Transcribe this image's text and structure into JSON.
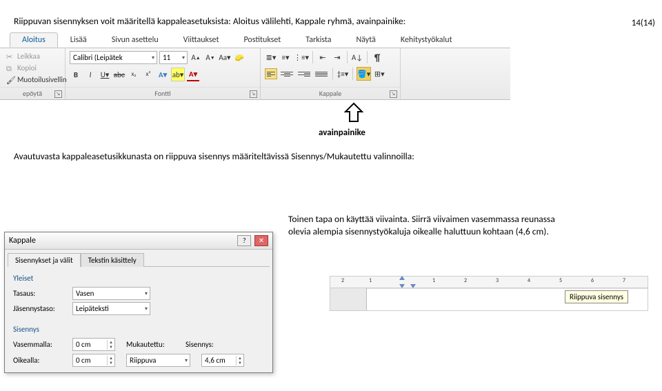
{
  "page_number": "14(14)",
  "body_text_1": "Riippuvan sisennyksen voit määritellä kappaleasetuksista: Aloitus välilehti, Kappale ryhmä, avainpainike:",
  "body_text_2": "Avautuvasta kappaleasetusikkunasta on riippuva sisennys määriteltävissä Sisennys/Mukautettu valinnoilla:",
  "right_text": "Toinen tapa on käyttää viivainta. Siirrä viivaimen vasemmassa reunassa olevia alempia sisennystyökaluja oikealle haluttuun kohtaan (4,6 cm).",
  "ribbon": {
    "tabs": [
      "Aloitus",
      "Lisää",
      "Sivun asettelu",
      "Viittaukset",
      "Postitukset",
      "Tarkista",
      "Näytä",
      "Kehitystyökalut"
    ],
    "clipboard": {
      "cut": "Leikkaa",
      "copy": "Kopioi",
      "format": "Muotoilusivellin",
      "clear": "epöytä"
    },
    "font": {
      "label": "Fontti",
      "name": "Calibri (Leipätek",
      "size": "11",
      "buttons": [
        "B",
        "I",
        "U"
      ]
    },
    "paragraph": {
      "label": "Kappale"
    }
  },
  "avain_label": "avainpainike",
  "dialog": {
    "title": "Kappale",
    "tab1": "Sisennykset ja välit",
    "tab2": "Tekstin käsittely",
    "section_yleiset": "Yleiset",
    "field_tasaus": "Tasaus:",
    "value_tasaus": "Vasen",
    "field_jasen": "Jäsennystaso:",
    "value_jasen": "Leipäteksti",
    "section_sisennys": "Sisennys",
    "field_vasemmalla": "Vasemmalla:",
    "value_vasemmalla": "0 cm",
    "field_oikealla": "Oikealla:",
    "value_oikealla": "0 cm",
    "field_mukautettu": "Mukautettu:",
    "value_mukautettu": "Riippuva",
    "field_sisennys": "Sisennys:",
    "value_sisennys": "4,6 cm"
  },
  "ruler": {
    "numbers": [
      "2",
      "1",
      "1",
      "2",
      "3",
      "4",
      "5",
      "6",
      "7"
    ],
    "tooltip": "Riippuva sisennys"
  }
}
